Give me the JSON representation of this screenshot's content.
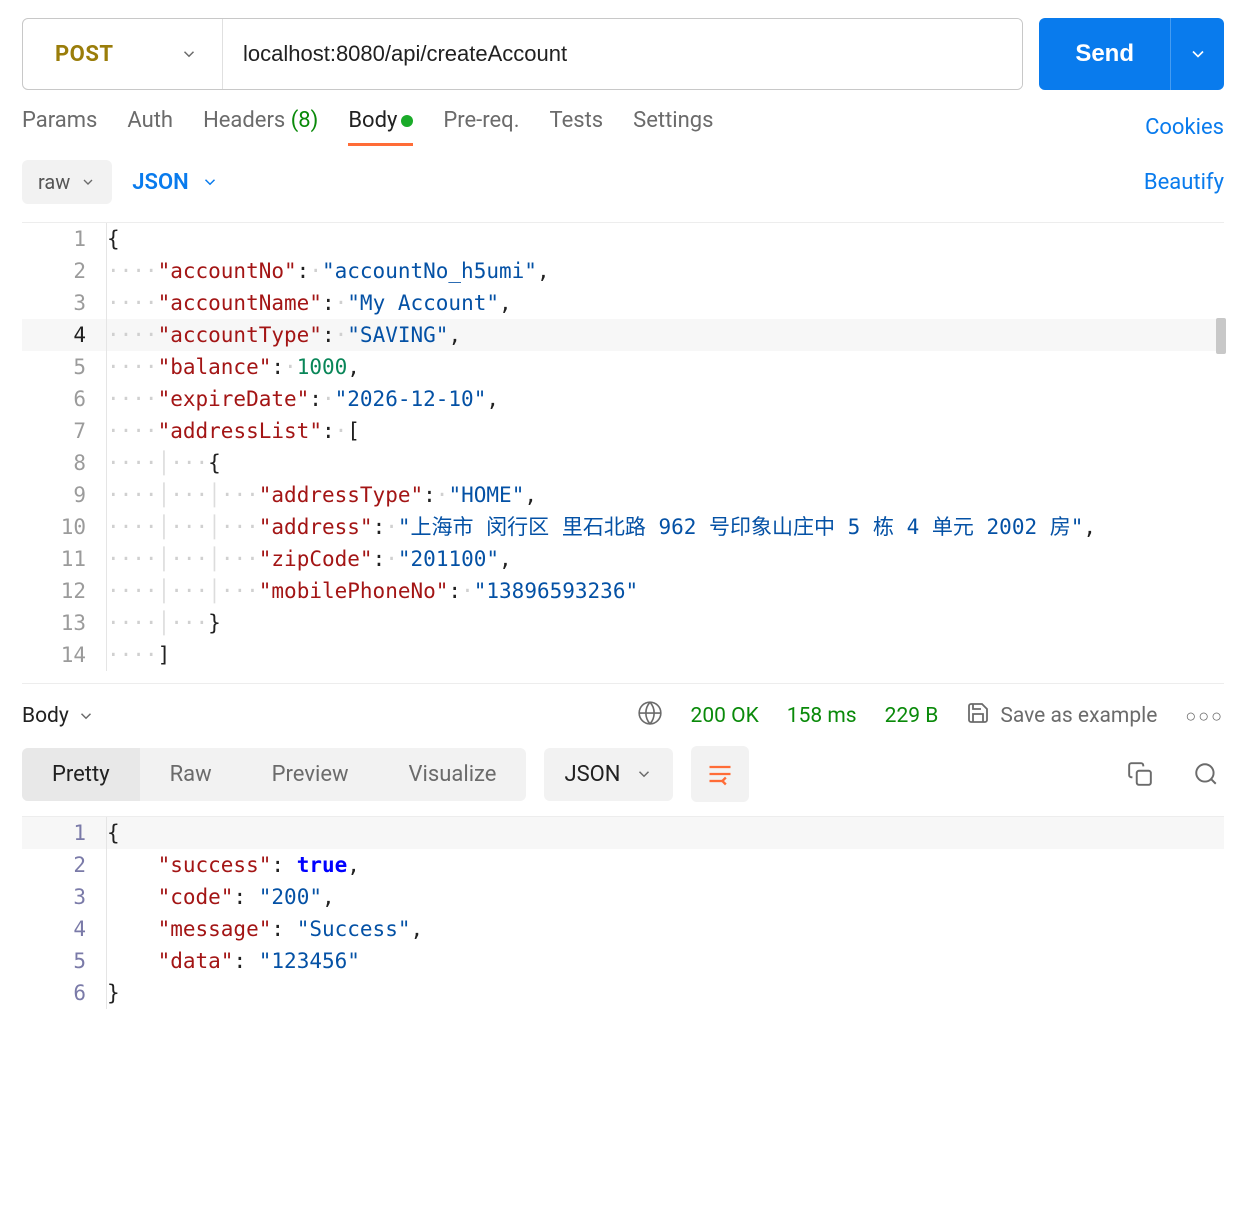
{
  "request": {
    "method": "POST",
    "url": "localhost:8080/api/createAccount",
    "send_label": "Send"
  },
  "tabs": {
    "params": "Params",
    "auth": "Auth",
    "headers": "Headers",
    "headers_count": "(8)",
    "body": "Body",
    "pre_req": "Pre-req.",
    "tests": "Tests",
    "settings": "Settings",
    "cookies": "Cookies"
  },
  "body_controls": {
    "raw": "raw",
    "format": "JSON",
    "beautify": "Beautify"
  },
  "request_body": {
    "accountNo": "accountNo_h5umi",
    "accountName": "My Account",
    "accountType": "SAVING",
    "balance": 1000,
    "expireDate": "2026-12-10",
    "addressList_key": "addressList",
    "address_item": {
      "addressType": "HOME",
      "address": "上海市 闵行区 里石北路 962 号印象山庄中 5 栋 4 单元 2002 房",
      "zipCode": "201100",
      "mobilePhoneNo": "13896593236"
    }
  },
  "response_bar": {
    "body_label": "Body",
    "status": "200 OK",
    "time": "158 ms",
    "size": "229 B",
    "save_example": "Save as example"
  },
  "response_tabs": {
    "pretty": "Pretty",
    "raw": "Raw",
    "preview": "Preview",
    "visualize": "Visualize",
    "format": "JSON"
  },
  "response_body": {
    "success": "true",
    "code": "200",
    "message": "Success",
    "data": "123456"
  },
  "line_numbers": {
    "req": [
      "1",
      "2",
      "3",
      "4",
      "5",
      "6",
      "7",
      "8",
      "9",
      "10",
      "11",
      "12",
      "13",
      "14"
    ],
    "resp": [
      "1",
      "2",
      "3",
      "4",
      "5",
      "6"
    ]
  }
}
